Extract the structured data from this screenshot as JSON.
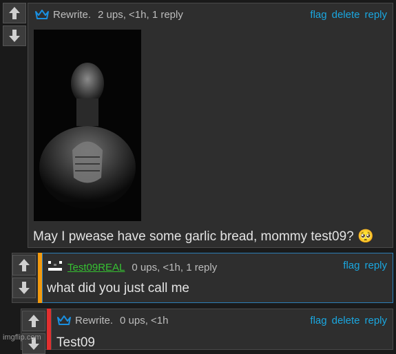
{
  "comment1": {
    "username": "Rewrite.",
    "meta": "2 ups, <1h, 1 reply",
    "actions": [
      "flag",
      "delete",
      "reply"
    ],
    "text": "May I pwease have some garlic bread, mommy test09? 🥺"
  },
  "comment2": {
    "username": "Test09REAL",
    "meta": "0 ups, <1h, 1 reply",
    "actions": [
      "flag",
      "reply"
    ],
    "text": "what did you just call me"
  },
  "comment3": {
    "username": "Rewrite.",
    "meta": "0 ups, <1h",
    "actions": [
      "flag",
      "delete",
      "reply"
    ],
    "text": "Test09"
  },
  "watermark": "imgflip.com",
  "colors": {
    "link": "#1aa7e0",
    "green_user": "#36c232",
    "orange_accent": "#f29a0f",
    "red_accent": "#e22f2f",
    "crown": "#1a8fe0"
  }
}
